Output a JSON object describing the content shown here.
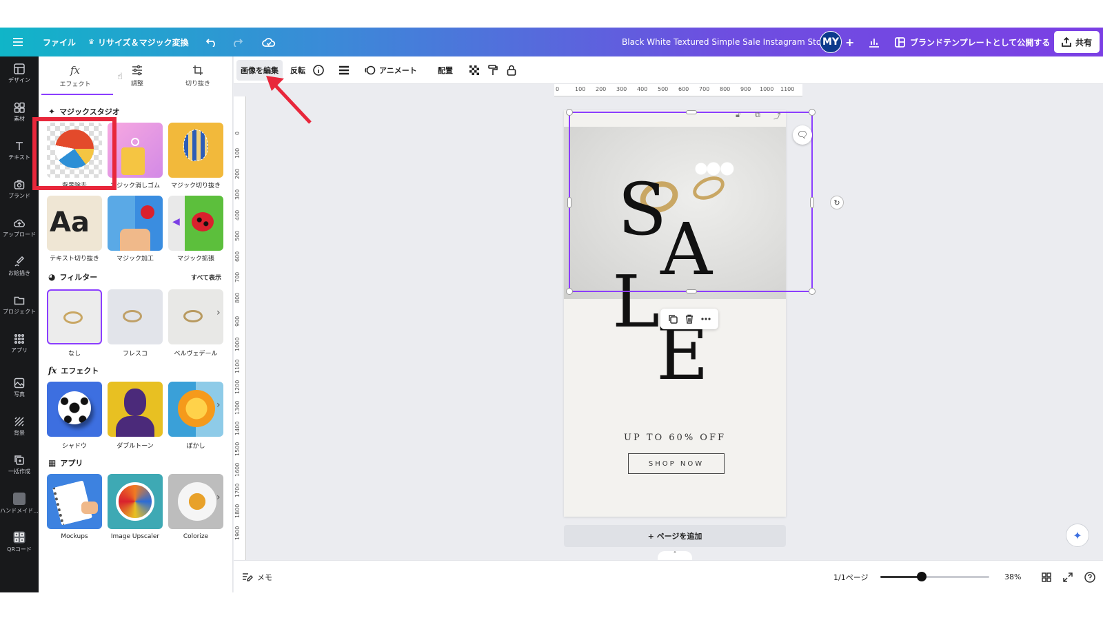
{
  "colors": {
    "accent": "#8b3dff",
    "annotation": "#e8273b",
    "rail_bg": "#18191b"
  },
  "topbar": {
    "menu_icon": "hamburger-icon",
    "file": "ファイル",
    "resize": "リサイズ＆マジック変換",
    "title": "Black White Textured Simple Sale Instagram Story",
    "avatar": "MY",
    "publish": "ブランドテンプレートとして公開する",
    "share": "共有"
  },
  "rail": [
    {
      "label": "デザイン",
      "icon": "layout-icon"
    },
    {
      "label": "素材",
      "icon": "elements-icon"
    },
    {
      "label": "テキスト",
      "icon": "text-icon"
    },
    {
      "label": "ブランド",
      "icon": "brand-icon"
    },
    {
      "label": "アップロード",
      "icon": "upload-icon"
    },
    {
      "label": "お絵描き",
      "icon": "draw-icon"
    },
    {
      "label": "プロジェクト",
      "icon": "folder-icon"
    },
    {
      "label": "アプリ",
      "icon": "apps-icon"
    },
    {
      "label": "写真",
      "icon": "photo-icon"
    },
    {
      "label": "背景",
      "icon": "background-icon"
    },
    {
      "label": "一括作成",
      "icon": "bulk-create-icon"
    },
    {
      "label": "ハンドメイド...",
      "icon": "handmade-icon"
    },
    {
      "label": "QRコード",
      "icon": "qr-icon"
    }
  ],
  "panel": {
    "tabs": [
      {
        "label": "エフェクト",
        "icon": "fx-icon"
      },
      {
        "label": "調整",
        "icon": "sliders-icon"
      },
      {
        "label": "切り抜き",
        "icon": "crop-icon"
      }
    ],
    "magic_studio": {
      "title": "マジックスタジオ",
      "items": [
        "背景除去",
        "マジック消しゴム",
        "マジック切り抜き",
        "テキスト切り抜き",
        "マジック加工",
        "マジック拡張"
      ]
    },
    "filters": {
      "title": "フィルター",
      "see_all": "すべて表示",
      "items": [
        "なし",
        "フレスコ",
        "ベルヴェデール"
      ]
    },
    "effects": {
      "title": "エフェクト",
      "items": [
        "シャドウ",
        "ダブルトーン",
        "ぼかし"
      ]
    },
    "apps": {
      "title": "アプリ",
      "items": [
        "Mockups",
        "Image Upscaler",
        "Colorize"
      ]
    }
  },
  "toolbar": {
    "edit_image": "画像を編集",
    "flip": "反転",
    "animate": "アニメート",
    "position": "配置"
  },
  "ruler": {
    "h": [
      "0",
      "100",
      "200",
      "300",
      "400",
      "500",
      "600",
      "700",
      "800",
      "900",
      "1000",
      "1100"
    ],
    "v": [
      "0",
      "100",
      "200",
      "300",
      "400",
      "500",
      "600",
      "700",
      "800",
      "900",
      "1000",
      "1100",
      "1200",
      "1300",
      "1400",
      "1500",
      "1600",
      "1700",
      "1800",
      "1900"
    ]
  },
  "design": {
    "letters": [
      "S",
      "A",
      "L",
      "E"
    ],
    "subtitle": "UP TO 60% OFF",
    "cta": "SHOP NOW"
  },
  "add_page": "+ ページを追加",
  "bottombar": {
    "notes": "メモ",
    "page_count": "1/1ページ",
    "zoom": "38%",
    "zoom_fraction": 0.38
  }
}
